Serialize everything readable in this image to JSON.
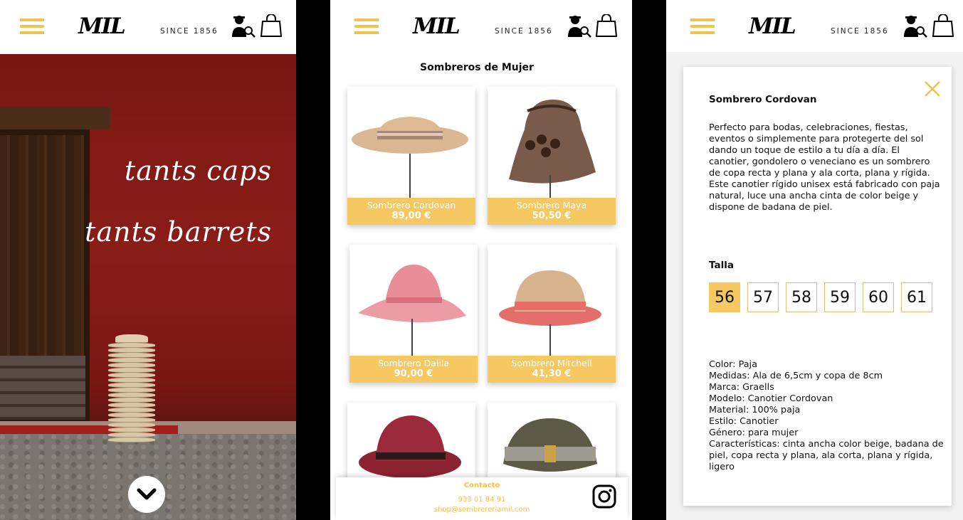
{
  "brand": {
    "logo_mark": "MIL",
    "since": "SINCE 1856"
  },
  "colors": {
    "accent": "#f5c862",
    "wall": "#7d1a16"
  },
  "icons": {
    "menu": "hamburger-icon",
    "user": "user-search-icon",
    "bag": "shopping-bag-icon",
    "instagram": "instagram-icon",
    "close": "close-icon",
    "scroll": "chevron-down-icon"
  },
  "hero": {
    "line1": "tants caps",
    "line2": "tants barrets"
  },
  "catalog": {
    "title": "Sombreros de Mujer",
    "products": [
      {
        "name": "Sombrero Cordovan",
        "price": "89,00 €"
      },
      {
        "name": "Sombrero Maya",
        "price": "50,50 €"
      },
      {
        "name": "Sombrero Dalila",
        "price": "90,00 €"
      },
      {
        "name": "Sombrero Mitchell",
        "price": "41,30 €"
      },
      {
        "name": "",
        "price": ""
      },
      {
        "name": "",
        "price": ""
      }
    ]
  },
  "footer": {
    "title": "Contacto",
    "phone": "933 01 84 91",
    "email": "shop@sombrereriamil.com"
  },
  "detail": {
    "title": "Sombrero Cordovan",
    "description": "Perfecto para bodas, celebraciones, fiestas, eventos o simplemente para protegerte del sol dando un toque de estilo a tu día a día. El canotier, gondolero o veneciano es un sombrero de copa recta y plana y ala corta, plana y rígida. Este canotier rígido unisex está fabricado con paja natural, luce una ancha cinta de color beige y dispone de badana de piel.",
    "size_label": "Talla",
    "sizes": [
      "56",
      "57",
      "58",
      "59",
      "60",
      "61"
    ],
    "selected_size": "56",
    "specs": [
      "Color: Paja",
      "Medidas: Ala de 6,5cm y copa de 8cm",
      "Marca: Graells",
      "Modelo: Canotier Cordovan",
      "Material: 100% paja",
      "Estilo: Canotier",
      "Género: para mujer",
      "Características: cinta ancha color beige, badana de piel, copa recta y plana, ala corta, plana y rígida, ligero"
    ]
  }
}
